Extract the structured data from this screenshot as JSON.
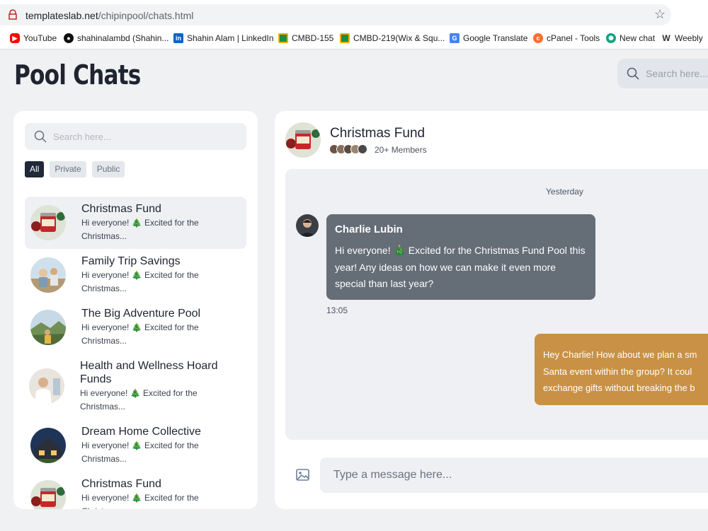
{
  "browser": {
    "url_host": "templateslab.net",
    "url_path": "/chipinpool/chats.html",
    "bookmarks": [
      {
        "label": "YouTube",
        "icon": "youtube-icon",
        "color": "#ff0000"
      },
      {
        "label": "shahinalambd (Shahin...",
        "icon": "github-icon",
        "color": "#111111"
      },
      {
        "label": "Shahin Alam | LinkedIn",
        "icon": "linkedin-icon",
        "color": "#0a66c2"
      },
      {
        "label": "CMBD-155",
        "icon": "classroom-icon",
        "color": "#1e8e3e"
      },
      {
        "label": "CMBD-219(Wix & Squ...",
        "icon": "classroom-icon",
        "color": "#1e8e3e"
      },
      {
        "label": "Google Translate",
        "icon": "translate-icon",
        "color": "#4285f4"
      },
      {
        "label": "cPanel - Tools",
        "icon": "cpanel-icon",
        "color": "#ff6c2c"
      },
      {
        "label": "New chat",
        "icon": "openai-icon",
        "color": "#10a37f"
      },
      {
        "label": "Weebly",
        "icon": "weebly-icon",
        "color": "#333333"
      }
    ]
  },
  "header": {
    "title": "Pool Chats",
    "search_placeholder": "Search here..."
  },
  "sidebar": {
    "search_placeholder": "Search here...",
    "filters": [
      "All",
      "Private",
      "Public"
    ],
    "active_filter": "All",
    "chats": [
      {
        "name": "Christmas Fund",
        "preview": "Hi everyone! 🎄 Excited for the Christmas...",
        "selected": true
      },
      {
        "name": "Family Trip Savings",
        "preview": "Hi everyone! 🎄 Excited for the Christmas..."
      },
      {
        "name": "The Big Adventure Pool",
        "preview": "Hi everyone! 🎄 Excited for the Christmas..."
      },
      {
        "name": "Health and Wellness Hoard Funds",
        "preview": "Hi everyone! 🎄 Excited for the Christmas..."
      },
      {
        "name": "Dream Home Collective",
        "preview": "Hi everyone! 🎄 Excited for the Christmas..."
      },
      {
        "name": "Christmas Fund",
        "preview": "Hi everyone! 🎄 Excited for the Christmas..."
      }
    ]
  },
  "conversation": {
    "title": "Christmas Fund",
    "members": "20+ Members",
    "day": "Yesterday",
    "incoming": {
      "sender": "Charlie Lubin",
      "text": "Hi everyone! 🎄 Excited for the Christmas Fund Pool this year! Any ideas on how we can make it even more special than last year?",
      "time": "13:05"
    },
    "outgoing": {
      "line1": "Hey Charlie! How about we plan a sm",
      "line2": "Santa event within the group? It coul",
      "line3": "exchange gifts without breaking the b"
    },
    "composer_placeholder": "Type a message here..."
  },
  "colors": {
    "incoming_bubble": "#656d77",
    "outgoing_bubble": "#c99145",
    "active_filter": "#1f2937"
  }
}
